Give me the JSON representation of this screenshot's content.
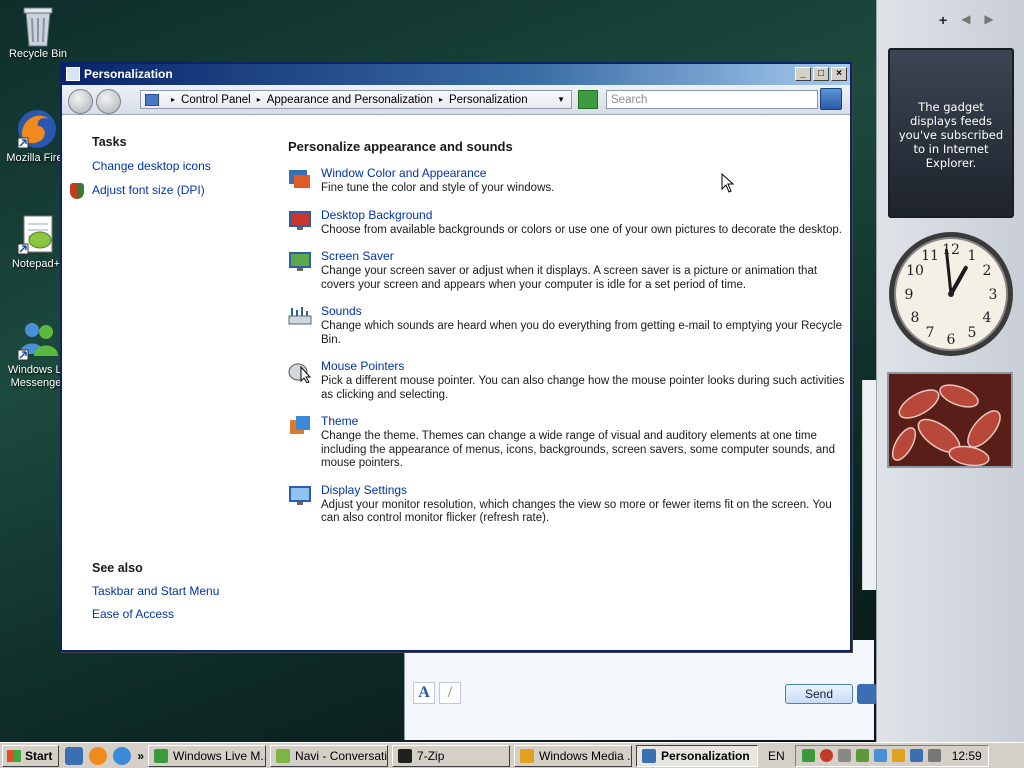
{
  "desktop": {
    "icons": [
      {
        "label": "Recycle Bin"
      },
      {
        "label": "Mozilla Firef"
      },
      {
        "label": "Notepad+"
      },
      {
        "label": "Windows Li Messenge"
      }
    ]
  },
  "window": {
    "title": "Personalization",
    "controls": {
      "minimize": "_",
      "maximize": "□",
      "close": "×"
    }
  },
  "address_bar": {
    "crumbs": [
      "Control Panel",
      "Appearance and Personalization",
      "Personalization"
    ],
    "search_placeholder": "Search"
  },
  "left_pane": {
    "tasks_title": "Tasks",
    "tasks": [
      "Change desktop icons",
      "Adjust font size (DPI)"
    ],
    "see_also_title": "See also",
    "see_also": [
      "Taskbar and Start Menu",
      "Ease of Access"
    ]
  },
  "main": {
    "heading": "Personalize appearance and sounds",
    "items": [
      {
        "title": "Window Color and Appearance",
        "desc": "Fine tune the color and style of your windows."
      },
      {
        "title": "Desktop Background",
        "desc": "Choose from available backgrounds or colors or use one of your own pictures to decorate the desktop."
      },
      {
        "title": "Screen Saver",
        "desc": "Change your screen saver or adjust when it displays. A screen saver is a picture or animation that covers your screen and appears when your computer is idle for a set period of time."
      },
      {
        "title": "Sounds",
        "desc": "Change which sounds are heard when you do everything from getting e-mail to emptying your Recycle Bin."
      },
      {
        "title": "Mouse Pointers",
        "desc": "Pick a different mouse pointer. You can also change how the mouse pointer looks during such activities as clicking and selecting."
      },
      {
        "title": "Theme",
        "desc": "Change the theme. Themes can change a wide range of visual and auditory elements at one time including the appearance of menus, icons, backgrounds, screen savers, some computer sounds, and mouse pointers."
      },
      {
        "title": "Display Settings",
        "desc": "Adjust your monitor resolution, which changes the view so more or fewer items fit on the screen. You can also control monitor flicker (refresh rate)."
      }
    ]
  },
  "sidebar": {
    "controls": [
      "+",
      "◀",
      "▶"
    ],
    "feed_text": "The gadget displays feeds you've subscribed to in Internet Explorer.",
    "clock": {
      "hour": 12,
      "minute": 59
    }
  },
  "background_chat": {
    "send_label": "Send",
    "font_button": "A"
  },
  "taskbar": {
    "start_label": "Start",
    "more": "»",
    "tasks": [
      {
        "label": "Windows Live M...",
        "icon_color": "#3c9a3c"
      },
      {
        "label": "Navi - Conversation",
        "icon_color": "#7bb54a"
      },
      {
        "label": "7-Zip",
        "icon_color": "#1f1f1f"
      },
      {
        "label": "Windows Media ...",
        "icon_color": "#e0a020"
      },
      {
        "label": "Personalization",
        "icon_color": "#3b6fb3",
        "active": true
      }
    ],
    "language": "EN",
    "time": "12:59"
  }
}
